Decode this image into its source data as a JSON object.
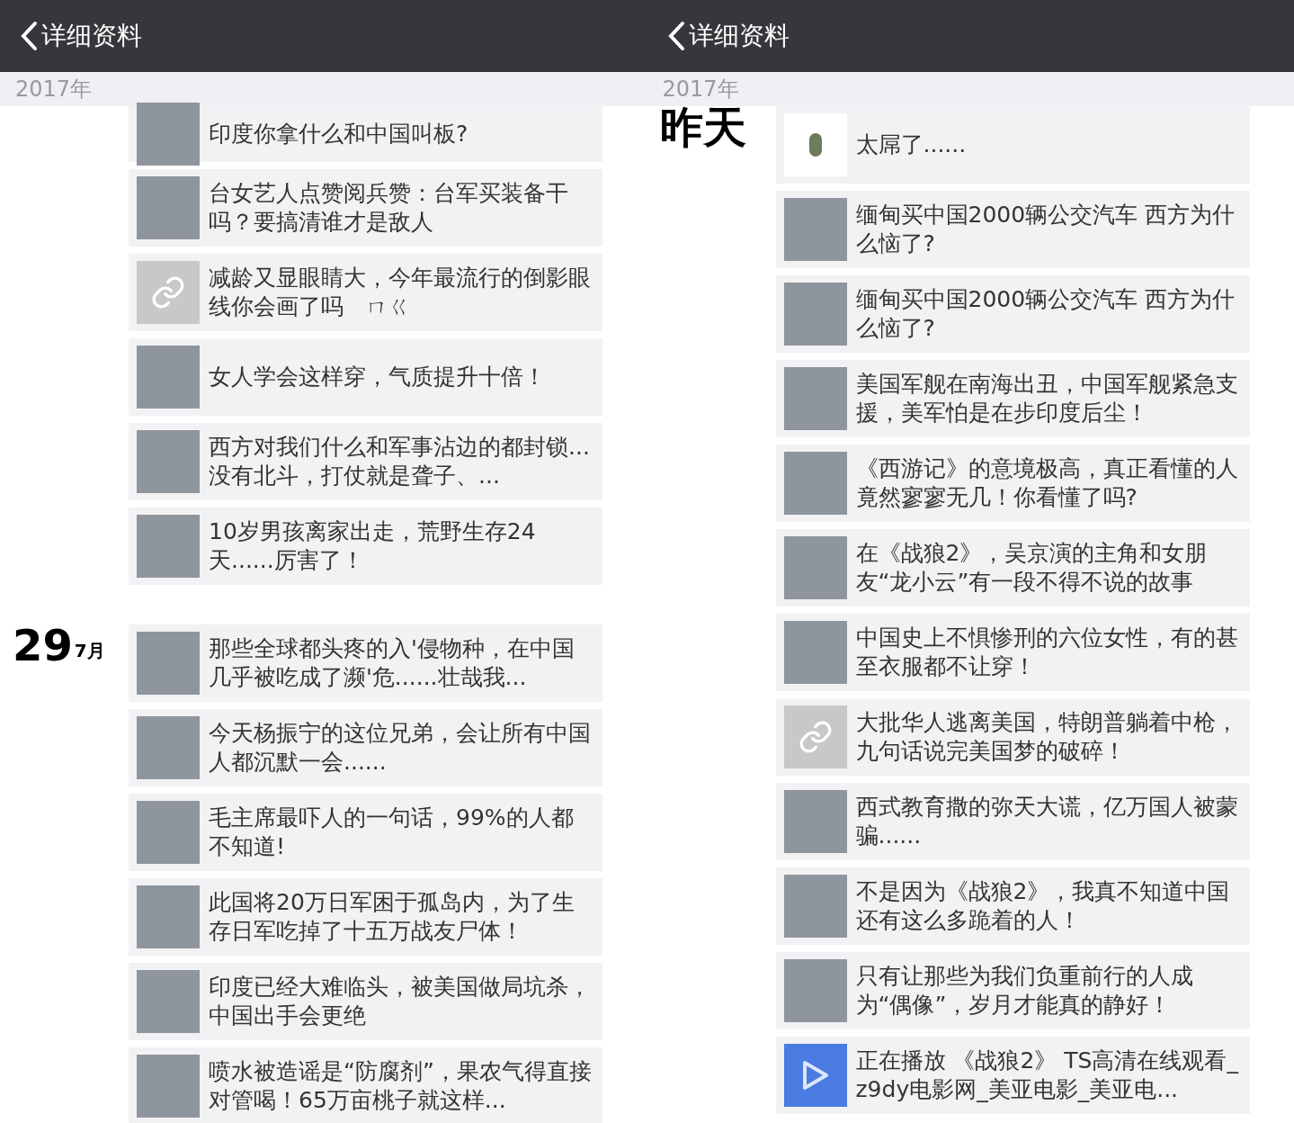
{
  "panes": [
    {
      "header": {
        "back_label": "详细资料"
      },
      "year": "2017年",
      "groups": [
        {
          "items": [
            {
              "kind": "photo",
              "text": "印度你拿什么和中国叫板?"
            }
          ]
        },
        {
          "items": [
            {
              "kind": "photo",
              "text": "台女艺人点赞阅兵赞：台军买装备干吗？要搞清谁才是敌人"
            },
            {
              "kind": "link",
              "text": "减龄又显眼睛大，今年最流行的倒影眼线你会画了吗　ㄇㄍ"
            },
            {
              "kind": "photo",
              "text": "女人学会这样穿，气质提升十倍！"
            },
            {
              "kind": "photo",
              "text": "西方对我们什么和军事沾边的都封锁...没有北斗，打仗就是聋子、..."
            },
            {
              "kind": "photo",
              "text": "10岁男孩离家出走，荒野生存24天......厉害了！"
            }
          ]
        },
        {
          "day": "29",
          "month": "7月",
          "items": [
            {
              "kind": "photo",
              "text": "那些全球都头疼的入'侵物种，在中国几乎被吃成了濒'危......壮哉我..."
            },
            {
              "kind": "photo",
              "text": "今天杨振宁的这位兄弟，会让所有中国人都沉默一会......"
            },
            {
              "kind": "photo",
              "text": "毛主席最吓人的一句话，99%的人都不知道!"
            },
            {
              "kind": "photo",
              "text": "此国将20万日军困于孤岛内，为了生存日军吃掉了十五万战友尸体！"
            },
            {
              "kind": "photo",
              "text": "印度已经大难临头，被美国做局坑杀，中国出手会更绝"
            },
            {
              "kind": "photo",
              "text": "喷水被造谣是“防腐剂”，果农气得直接对管喝！65万亩桃子就这样..."
            }
          ]
        }
      ]
    },
    {
      "header": {
        "back_label": "详细资料"
      },
      "year": "2017年",
      "groups": [
        {
          "day": "昨天",
          "items": [
            {
              "kind": "sticker",
              "text": "太屌了......"
            },
            {
              "kind": "photo",
              "text": "缅甸买中国2000辆公交汽车 西方为什么恼了?"
            },
            {
              "kind": "photo",
              "text": "缅甸买中国2000辆公交汽车 西方为什么恼了?"
            },
            {
              "kind": "photo",
              "text": "美国军舰在南海出丑，中国军舰紧急支援，美军怕是在步印度后尘！"
            },
            {
              "kind": "photo",
              "text": "《西游记》的意境极高，真正看懂的人竟然寥寥无几！你看懂了吗?"
            },
            {
              "kind": "photo",
              "text": "在《战狼2》，吴京演的主角和女朋友“龙小云”有一段不得不说的故事"
            },
            {
              "kind": "photo",
              "text": "中国史上不惧惨刑的六位女性，有的甚至衣服都不让穿！"
            },
            {
              "kind": "link",
              "text": "大批华人逃离美国，特朗普躺着中枪，九句话说完美国梦的破碎！"
            },
            {
              "kind": "photo",
              "text": "西式教育撒的弥天大谎，亿万国人被蒙骗......"
            },
            {
              "kind": "photo",
              "text": "不是因为《战狼2》，我真不知道中国还有这么多跪着的人！"
            },
            {
              "kind": "photo",
              "text": "只有让那些为我们负重前行的人成为“偶像”，岁月才能真的静好！"
            },
            {
              "kind": "video",
              "text": "正在播放 《战狼2》 TS高清在线观看_z9dy电影网_美亚电影_美亚电..."
            }
          ]
        }
      ]
    }
  ]
}
